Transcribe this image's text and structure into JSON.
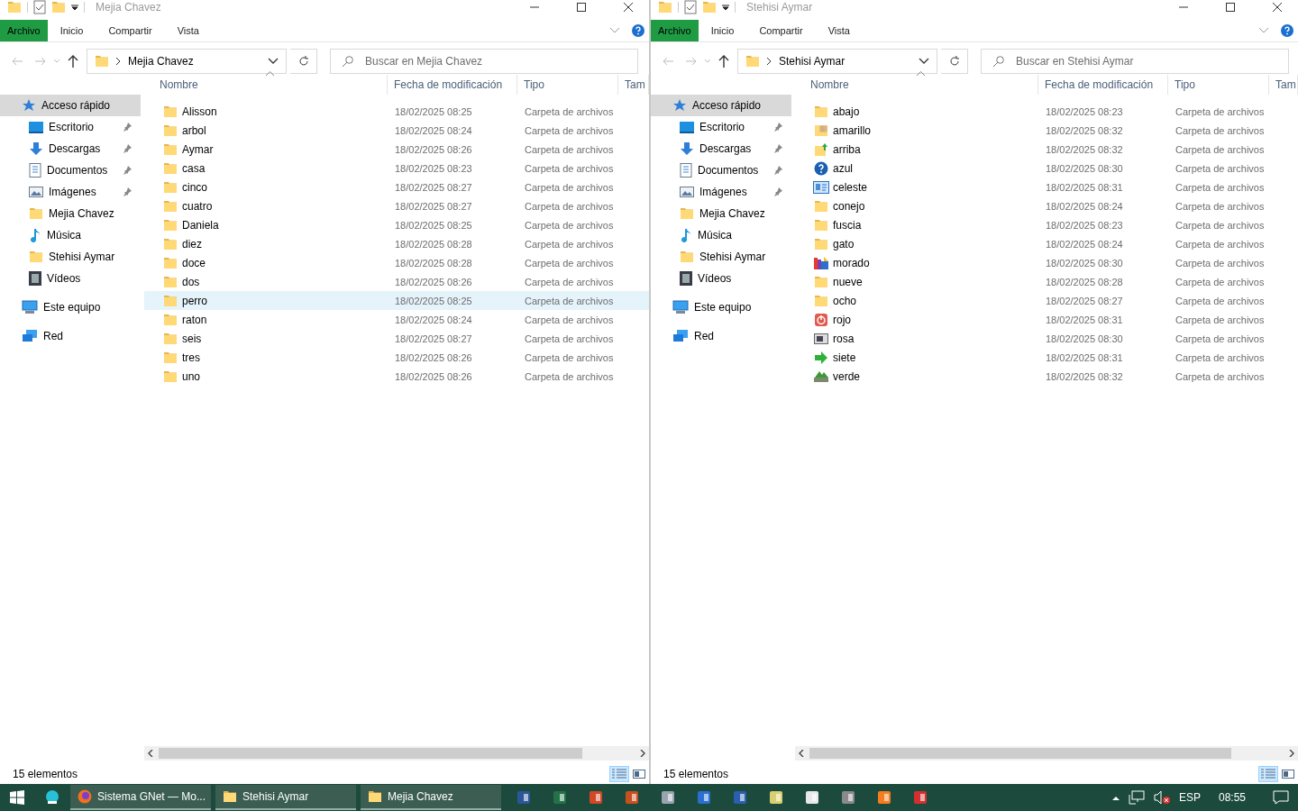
{
  "windows": [
    {
      "title": "Mejia Chavez",
      "ribbon_tabs": [
        {
          "label": "Archivo",
          "selected": true
        },
        {
          "label": "Inicio",
          "selected": false
        },
        {
          "label": "Compartir",
          "selected": false
        },
        {
          "label": "Vista",
          "selected": false
        }
      ],
      "address": "Mejia Chavez",
      "search": {
        "placeholder": "Buscar en Mejia Chavez"
      },
      "columns": [
        "Nombre",
        "Fecha de modificación",
        "Tipo",
        "Tam"
      ],
      "nav": [
        {
          "label": "Acceso rápido",
          "kind": "quick",
          "selected": true,
          "pinned": false,
          "children": [
            {
              "label": "Escritorio",
              "kind": "desktop",
              "selected": false,
              "pinned": true
            },
            {
              "label": "Descargas",
              "kind": "download",
              "selected": false,
              "pinned": true
            },
            {
              "label": "Documentos",
              "kind": "document",
              "selected": false,
              "pinned": true
            },
            {
              "label": "Imágenes",
              "kind": "pictures",
              "selected": false,
              "pinned": true
            },
            {
              "label": "Mejia Chavez",
              "kind": "folder",
              "selected": false,
              "pinned": false
            },
            {
              "label": "Música",
              "kind": "music",
              "selected": false,
              "pinned": false
            },
            {
              "label": "Stehisi Aymar",
              "kind": "folder",
              "selected": false,
              "pinned": false
            },
            {
              "label": "Vídeos",
              "kind": "video",
              "selected": false,
              "pinned": false
            }
          ]
        },
        {
          "label": "Este equipo",
          "kind": "pc",
          "selected": false,
          "pinned": false
        },
        {
          "label": "Red",
          "kind": "network",
          "selected": false,
          "pinned": false
        }
      ],
      "files": [
        {
          "name": "Alisson",
          "date": "18/02/2025 08:25",
          "type": "Carpeta de archivos",
          "kind": "folder",
          "selected": false
        },
        {
          "name": "arbol",
          "date": "18/02/2025 08:24",
          "type": "Carpeta de archivos",
          "kind": "folder",
          "selected": false
        },
        {
          "name": "Aymar",
          "date": "18/02/2025 08:26",
          "type": "Carpeta de archivos",
          "kind": "folder",
          "selected": false
        },
        {
          "name": "casa",
          "date": "18/02/2025 08:23",
          "type": "Carpeta de archivos",
          "kind": "folder",
          "selected": false
        },
        {
          "name": "cinco",
          "date": "18/02/2025 08:27",
          "type": "Carpeta de archivos",
          "kind": "folder",
          "selected": false
        },
        {
          "name": "cuatro",
          "date": "18/02/2025 08:27",
          "type": "Carpeta de archivos",
          "kind": "folder",
          "selected": false
        },
        {
          "name": "Daniela",
          "date": "18/02/2025 08:25",
          "type": "Carpeta de archivos",
          "kind": "folder",
          "selected": false
        },
        {
          "name": "diez",
          "date": "18/02/2025 08:28",
          "type": "Carpeta de archivos",
          "kind": "folder",
          "selected": false
        },
        {
          "name": "doce",
          "date": "18/02/2025 08:28",
          "type": "Carpeta de archivos",
          "kind": "folder",
          "selected": false
        },
        {
          "name": "dos",
          "date": "18/02/2025 08:26",
          "type": "Carpeta de archivos",
          "kind": "folder",
          "selected": false
        },
        {
          "name": "perro",
          "date": "18/02/2025 08:25",
          "type": "Carpeta de archivos",
          "kind": "folder",
          "selected": true
        },
        {
          "name": "raton",
          "date": "18/02/2025 08:24",
          "type": "Carpeta de archivos",
          "kind": "folder",
          "selected": false
        },
        {
          "name": "seis",
          "date": "18/02/2025 08:27",
          "type": "Carpeta de archivos",
          "kind": "folder",
          "selected": false
        },
        {
          "name": "tres",
          "date": "18/02/2025 08:26",
          "type": "Carpeta de archivos",
          "kind": "folder",
          "selected": false
        },
        {
          "name": "uno",
          "date": "18/02/2025 08:26",
          "type": "Carpeta de archivos",
          "kind": "folder",
          "selected": false
        }
      ],
      "status": "15 elementos"
    },
    {
      "title": "Stehisi Aymar",
      "ribbon_tabs": [
        {
          "label": "Archivo",
          "selected": true
        },
        {
          "label": "Inicio",
          "selected": false
        },
        {
          "label": "Compartir",
          "selected": false
        },
        {
          "label": "Vista",
          "selected": false
        }
      ],
      "address": "Stehisi Aymar",
      "search": {
        "placeholder": "Buscar en Stehisi Aymar"
      },
      "columns": [
        "Nombre",
        "Fecha de modificación",
        "Tipo",
        "Tam"
      ],
      "nav": [
        {
          "label": "Acceso rápido",
          "kind": "quick",
          "selected": true,
          "pinned": false,
          "children": [
            {
              "label": "Escritorio",
              "kind": "desktop",
              "selected": false,
              "pinned": true
            },
            {
              "label": "Descargas",
              "kind": "download",
              "selected": false,
              "pinned": true
            },
            {
              "label": "Documentos",
              "kind": "document",
              "selected": false,
              "pinned": true
            },
            {
              "label": "Imágenes",
              "kind": "pictures",
              "selected": false,
              "pinned": true
            },
            {
              "label": "Mejia Chavez",
              "kind": "folder",
              "selected": false,
              "pinned": false
            },
            {
              "label": "Música",
              "kind": "music",
              "selected": false,
              "pinned": false
            },
            {
              "label": "Stehisi Aymar",
              "kind": "folder",
              "selected": false,
              "pinned": false
            },
            {
              "label": "Vídeos",
              "kind": "video",
              "selected": false,
              "pinned": false
            }
          ]
        },
        {
          "label": "Este equipo",
          "kind": "pc",
          "selected": false,
          "pinned": false
        },
        {
          "label": "Red",
          "kind": "network",
          "selected": false,
          "pinned": false
        }
      ],
      "files": [
        {
          "name": "abajo",
          "date": "18/02/2025 08:23",
          "type": "Carpeta de archivos",
          "kind": "folder",
          "selected": false
        },
        {
          "name": "amarillo",
          "date": "18/02/2025 08:32",
          "type": "Carpeta de archivos",
          "kind": "grid",
          "selected": false
        },
        {
          "name": "arriba",
          "date": "18/02/2025 08:32",
          "type": "Carpeta de archivos",
          "kind": "up",
          "selected": false
        },
        {
          "name": "azul",
          "date": "18/02/2025 08:30",
          "type": "Carpeta de archivos",
          "kind": "help",
          "selected": false
        },
        {
          "name": "celeste",
          "date": "18/02/2025 08:31",
          "type": "Carpeta de archivos",
          "kind": "card",
          "selected": false
        },
        {
          "name": "conejo",
          "date": "18/02/2025 08:24",
          "type": "Carpeta de archivos",
          "kind": "folder",
          "selected": false
        },
        {
          "name": "fuscia",
          "date": "18/02/2025 08:23",
          "type": "Carpeta de archivos",
          "kind": "folder",
          "selected": false
        },
        {
          "name": "gato",
          "date": "18/02/2025 08:24",
          "type": "Carpeta de archivos",
          "kind": "folder",
          "selected": false
        },
        {
          "name": "morado",
          "date": "18/02/2025 08:30",
          "type": "Carpeta de archivos",
          "kind": "colorful",
          "selected": false
        },
        {
          "name": "nueve",
          "date": "18/02/2025 08:28",
          "type": "Carpeta de archivos",
          "kind": "folder",
          "selected": false
        },
        {
          "name": "ocho",
          "date": "18/02/2025 08:27",
          "type": "Carpeta de archivos",
          "kind": "folder",
          "selected": false
        },
        {
          "name": "rojo",
          "date": "18/02/2025 08:31",
          "type": "Carpeta de archivos",
          "kind": "power",
          "selected": false
        },
        {
          "name": "rosa",
          "date": "18/02/2025 08:30",
          "type": "Carpeta de archivos",
          "kind": "window",
          "selected": false
        },
        {
          "name": "siete",
          "date": "18/02/2025 08:31",
          "type": "Carpeta de archivos",
          "kind": "arrow",
          "selected": false
        },
        {
          "name": "verde",
          "date": "18/02/2025 08:32",
          "type": "Carpeta de archivos",
          "kind": "stack",
          "selected": false
        }
      ],
      "status": "15 elementos"
    }
  ],
  "taskbar": {
    "windows": [
      {
        "label": "Sistema GNet — Mo...",
        "kind": "browser"
      },
      {
        "label": "Stehisi Aymar",
        "kind": "folder"
      },
      {
        "label": "Mejia Chavez",
        "kind": "folder"
      }
    ],
    "apps": [
      {
        "kind": "word"
      },
      {
        "kind": "excel"
      },
      {
        "kind": "powerpoint"
      },
      {
        "kind": "tool"
      },
      {
        "kind": "keyboard"
      },
      {
        "kind": "outlook"
      },
      {
        "kind": "monitor"
      },
      {
        "kind": "notepad"
      },
      {
        "kind": "pattern"
      },
      {
        "kind": "server"
      },
      {
        "kind": "xampp"
      },
      {
        "kind": "flash"
      }
    ],
    "language": "ESP",
    "time": "08:55"
  }
}
